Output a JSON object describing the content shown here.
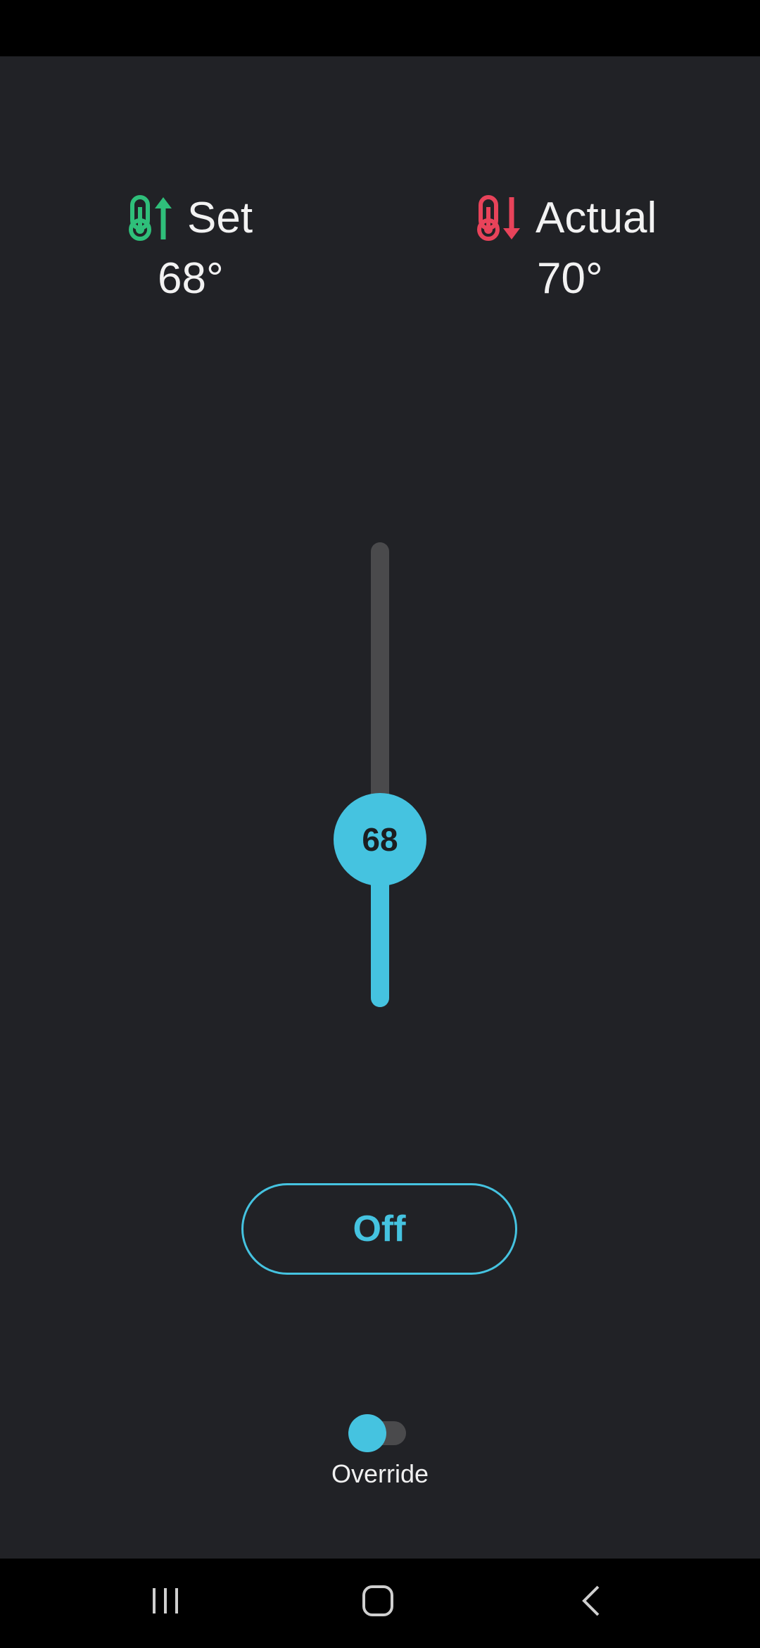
{
  "readouts": {
    "set": {
      "label": "Set",
      "value": "68°",
      "icon": "thermometer-up-icon",
      "color": "#2fbf7a"
    },
    "actual": {
      "label": "Actual",
      "value": "70°",
      "icon": "thermometer-down-icon",
      "color": "#e8435a"
    }
  },
  "slider": {
    "value": "68",
    "level": 0.36,
    "accent": "#45c3e0",
    "track_color": "#4a4a4c"
  },
  "mode_button": {
    "label": "Off"
  },
  "override": {
    "label": "Override",
    "enabled": true
  },
  "nav": {
    "recents_icon": "recents-icon",
    "home_icon": "home-icon",
    "back_icon": "back-icon"
  },
  "colors": {
    "background": "#212226",
    "system_bars": "#000000"
  }
}
